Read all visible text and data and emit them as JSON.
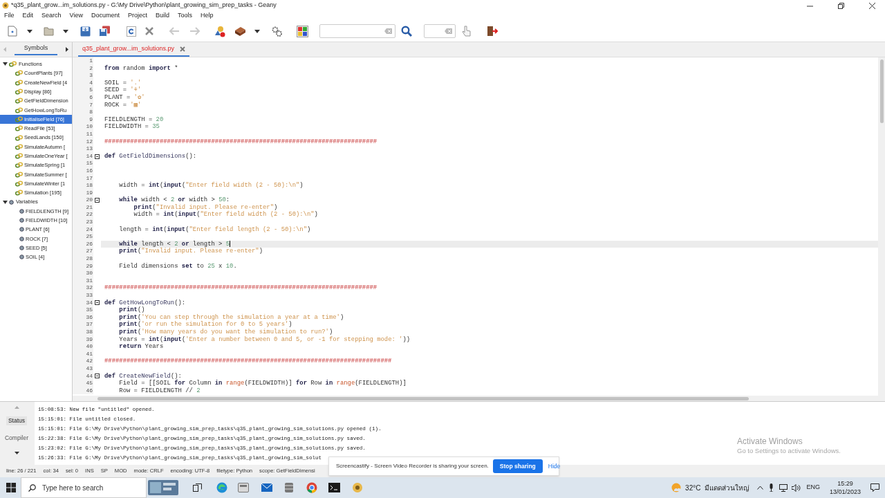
{
  "window": {
    "title": "*q35_plant_grow...im_solutions.py - G:\\My Drive\\Python\\plant_growing_sim_prep_tasks - Geany"
  },
  "menu": [
    "File",
    "Edit",
    "Search",
    "View",
    "Document",
    "Project",
    "Build",
    "Tools",
    "Help"
  ],
  "sidebar": {
    "tab": "Symbols",
    "tree": [
      {
        "label": "Functions",
        "kind": "function",
        "expanded": true,
        "selected": false,
        "children": [
          {
            "label": "CountPlants [97]",
            "kind": "function",
            "selected": false
          },
          {
            "label": "CreateNewField [4",
            "kind": "function",
            "selected": false
          },
          {
            "label": "Display [86]",
            "kind": "function",
            "selected": false
          },
          {
            "label": "GetFieldDimension",
            "kind": "function",
            "selected": false
          },
          {
            "label": "GetHowLongToRu",
            "kind": "function",
            "selected": false
          },
          {
            "label": "InitialiseField [76]",
            "kind": "function",
            "selected": true
          },
          {
            "label": "ReadFile [53]",
            "kind": "function",
            "selected": false
          },
          {
            "label": "SeedLands [150]",
            "kind": "function",
            "selected": false
          },
          {
            "label": "SimulateAutumn [",
            "kind": "function",
            "selected": false
          },
          {
            "label": "SimulateOneYear [",
            "kind": "function",
            "selected": false
          },
          {
            "label": "SimulateSpring [1",
            "kind": "function",
            "selected": false
          },
          {
            "label": "SimulateSummer [",
            "kind": "function",
            "selected": false
          },
          {
            "label": "SimulateWinter [1",
            "kind": "function",
            "selected": false
          },
          {
            "label": "Simulation [195]",
            "kind": "function",
            "selected": false
          }
        ]
      },
      {
        "label": "Variables",
        "kind": "variable",
        "expanded": true,
        "selected": false,
        "children": [
          {
            "label": "FIELDLENGTH [9]",
            "kind": "variable",
            "selected": false
          },
          {
            "label": "FIELDWIDTH [10]",
            "kind": "variable",
            "selected": false
          },
          {
            "label": "PLANT [6]",
            "kind": "variable",
            "selected": false
          },
          {
            "label": "ROCK [7]",
            "kind": "variable",
            "selected": false
          },
          {
            "label": "SEED [5]",
            "kind": "variable",
            "selected": false
          },
          {
            "label": "SOIL [4]",
            "kind": "variable",
            "selected": false
          }
        ]
      }
    ]
  },
  "editor_tab": {
    "label": "q35_plant_grow...im_solutions.py",
    "modified": true
  },
  "lines": [
    {
      "n": "1",
      "fold": false,
      "current": false
    },
    {
      "n": "2",
      "fold": false,
      "current": false,
      "tokens": [
        {
          "kind": "kw",
          "text": "from"
        },
        {
          "kind": "plain",
          "text": " random "
        },
        {
          "kind": "kw",
          "text": "import"
        },
        {
          "kind": "plain",
          "text": " *"
        }
      ]
    },
    {
      "n": "3",
      "fold": false,
      "current": false
    },
    {
      "n": "4",
      "fold": false,
      "current": false,
      "tokens": [
        {
          "kind": "plain",
          "text": "SOIL = "
        },
        {
          "kind": "str",
          "text": "'.'"
        }
      ]
    },
    {
      "n": "5",
      "fold": false,
      "current": false,
      "tokens": [
        {
          "kind": "plain",
          "text": "SEED = "
        },
        {
          "kind": "str",
          "text": "'⚘'"
        }
      ]
    },
    {
      "n": "6",
      "fold": false,
      "current": false,
      "tokens": [
        {
          "kind": "plain",
          "text": "PLANT = "
        },
        {
          "kind": "str",
          "text": "'✿'"
        }
      ]
    },
    {
      "n": "7",
      "fold": false,
      "current": false,
      "tokens": [
        {
          "kind": "plain",
          "text": "ROCK = "
        },
        {
          "kind": "str",
          "text": "'▩'"
        }
      ]
    },
    {
      "n": "8",
      "fold": false,
      "current": false
    },
    {
      "n": "9",
      "fold": false,
      "current": false,
      "tokens": [
        {
          "kind": "plain",
          "text": "FIELDLENGTH = "
        },
        {
          "kind": "num",
          "text": "20"
        }
      ]
    },
    {
      "n": "10",
      "fold": false,
      "current": false,
      "tokens": [
        {
          "kind": "plain",
          "text": "FIELDWIDTH = "
        },
        {
          "kind": "num",
          "text": "35"
        }
      ]
    },
    {
      "n": "11",
      "fold": false,
      "current": false
    },
    {
      "n": "12",
      "fold": false,
      "current": false,
      "tokens": [
        {
          "kind": "hash",
          "text": "##########################################################################"
        }
      ]
    },
    {
      "n": "13",
      "fold": false,
      "current": false
    },
    {
      "n": "14",
      "fold": true,
      "current": false,
      "tokens": [
        {
          "kind": "kw",
          "text": "def"
        },
        {
          "kind": "name",
          "text": " GetFieldDimensions"
        },
        {
          "kind": "plain",
          "text": "():"
        }
      ]
    },
    {
      "n": "15",
      "fold": false,
      "current": false
    },
    {
      "n": "16",
      "fold": false,
      "current": false
    },
    {
      "n": "17",
      "fold": false,
      "current": false
    },
    {
      "n": "18",
      "fold": false,
      "current": false,
      "tokens": [
        {
          "kind": "plain",
          "text": "    width = "
        },
        {
          "kind": "kw",
          "text": "int"
        },
        {
          "kind": "plain",
          "text": "("
        },
        {
          "kind": "kw",
          "text": "input"
        },
        {
          "kind": "plain",
          "text": "("
        },
        {
          "kind": "str",
          "text": "\"Enter field width (2 - 50):\\n\""
        },
        {
          "kind": "plain",
          "text": ")"
        }
      ]
    },
    {
      "n": "19",
      "fold": false,
      "current": false
    },
    {
      "n": "20",
      "fold": true,
      "current": false,
      "tokens": [
        {
          "kind": "kw",
          "text": "    while"
        },
        {
          "kind": "plain",
          "text": " width < "
        },
        {
          "kind": "num",
          "text": "2"
        },
        {
          "kind": "kw",
          "text": " or"
        },
        {
          "kind": "plain",
          "text": " width > "
        },
        {
          "kind": "num",
          "text": "50"
        },
        {
          "kind": "plain",
          "text": ":"
        }
      ]
    },
    {
      "n": "21",
      "fold": false,
      "current": false,
      "tokens": [
        {
          "kind": "kw",
          "text": "        print"
        },
        {
          "kind": "plain",
          "text": "("
        },
        {
          "kind": "str",
          "text": "\"Invalid input. Please re-enter\""
        },
        {
          "kind": "plain",
          "text": ")"
        }
      ]
    },
    {
      "n": "22",
      "fold": false,
      "current": false,
      "tokens": [
        {
          "kind": "plain",
          "text": "        width = "
        },
        {
          "kind": "kw",
          "text": "int"
        },
        {
          "kind": "plain",
          "text": "("
        },
        {
          "kind": "kw",
          "text": "input"
        },
        {
          "kind": "plain",
          "text": "("
        },
        {
          "kind": "str",
          "text": "\"Enter field width (2 - 50):\\n\""
        },
        {
          "kind": "plain",
          "text": ")"
        }
      ]
    },
    {
      "n": "23",
      "fold": false,
      "current": false
    },
    {
      "n": "24",
      "fold": false,
      "current": false,
      "tokens": [
        {
          "kind": "plain",
          "text": "    length = "
        },
        {
          "kind": "kw",
          "text": "int"
        },
        {
          "kind": "plain",
          "text": "("
        },
        {
          "kind": "kw",
          "text": "input"
        },
        {
          "kind": "plain",
          "text": "("
        },
        {
          "kind": "str",
          "text": "\"Enter field length (2 - 50):\\n\""
        },
        {
          "kind": "plain",
          "text": ")"
        }
      ]
    },
    {
      "n": "25",
      "fold": false,
      "current": false
    },
    {
      "n": "26",
      "fold": false,
      "current": true,
      "tokens": [
        {
          "kind": "kw",
          "text": "    while"
        },
        {
          "kind": "plain",
          "text": " length < "
        },
        {
          "kind": "num",
          "text": "2"
        },
        {
          "kind": "kw",
          "text": " or"
        },
        {
          "kind": "plain",
          "text": " length > "
        },
        {
          "kind": "num",
          "text": "5"
        }
      ]
    },
    {
      "n": "27",
      "fold": false,
      "current": false,
      "tokens": [
        {
          "kind": "kw",
          "text": "    print"
        },
        {
          "kind": "plain",
          "text": "("
        },
        {
          "kind": "str",
          "text": "\"Invalid input. Please re-enter\""
        },
        {
          "kind": "plain",
          "text": ")"
        }
      ]
    },
    {
      "n": "28",
      "fold": false,
      "current": false
    },
    {
      "n": "29",
      "fold": false,
      "current": false,
      "tokens": [
        {
          "kind": "plain",
          "text": "    Field dimensions "
        },
        {
          "kind": "kw",
          "text": "set"
        },
        {
          "kind": "plain",
          "text": " to "
        },
        {
          "kind": "num",
          "text": "25"
        },
        {
          "kind": "plain",
          "text": " x "
        },
        {
          "kind": "num",
          "text": "10"
        },
        {
          "kind": "plain",
          "text": "."
        }
      ]
    },
    {
      "n": "30",
      "fold": false,
      "current": false
    },
    {
      "n": "31",
      "fold": false,
      "current": false
    },
    {
      "n": "32",
      "fold": false,
      "current": false,
      "tokens": [
        {
          "kind": "hash",
          "text": "##########################################################################"
        }
      ]
    },
    {
      "n": "33",
      "fold": false,
      "current": false
    },
    {
      "n": "34",
      "fold": true,
      "current": false,
      "tokens": [
        {
          "kind": "kw",
          "text": "def"
        },
        {
          "kind": "name",
          "text": " GetHowLongToRun"
        },
        {
          "kind": "plain",
          "text": "():"
        }
      ]
    },
    {
      "n": "35",
      "fold": false,
      "current": false,
      "tokens": [
        {
          "kind": "kw",
          "text": "    print"
        },
        {
          "kind": "plain",
          "text": "()"
        }
      ]
    },
    {
      "n": "36",
      "fold": false,
      "current": false,
      "tokens": [
        {
          "kind": "kw",
          "text": "    print"
        },
        {
          "kind": "plain",
          "text": "("
        },
        {
          "kind": "str",
          "text": "'You can step through the simulation a year at a time'"
        },
        {
          "kind": "plain",
          "text": ")"
        }
      ]
    },
    {
      "n": "37",
      "fold": false,
      "current": false,
      "tokens": [
        {
          "kind": "kw",
          "text": "    print"
        },
        {
          "kind": "plain",
          "text": "("
        },
        {
          "kind": "str",
          "text": "'or run the simulation for 0 to 5 years'"
        },
        {
          "kind": "plain",
          "text": ")"
        }
      ]
    },
    {
      "n": "38",
      "fold": false,
      "current": false,
      "tokens": [
        {
          "kind": "kw",
          "text": "    print"
        },
        {
          "kind": "plain",
          "text": "("
        },
        {
          "kind": "str",
          "text": "'How many years do you want the simulation to run?'"
        },
        {
          "kind": "plain",
          "text": ")"
        }
      ]
    },
    {
      "n": "39",
      "fold": false,
      "current": false,
      "tokens": [
        {
          "kind": "plain",
          "text": "    Years = "
        },
        {
          "kind": "kw",
          "text": "int"
        },
        {
          "kind": "plain",
          "text": "("
        },
        {
          "kind": "kw",
          "text": "input"
        },
        {
          "kind": "plain",
          "text": "("
        },
        {
          "kind": "str",
          "text": "'Enter a number between 0 and 5, or -1 for stepping mode: '"
        },
        {
          "kind": "plain",
          "text": "))"
        }
      ]
    },
    {
      "n": "40",
      "fold": false,
      "current": false,
      "tokens": [
        {
          "kind": "kw",
          "text": "    return"
        },
        {
          "kind": "plain",
          "text": " Years"
        }
      ]
    },
    {
      "n": "41",
      "fold": false,
      "current": false
    },
    {
      "n": "42",
      "fold": false,
      "current": false,
      "tokens": [
        {
          "kind": "hash",
          "text": "##############################################################################"
        }
      ]
    },
    {
      "n": "43",
      "fold": false,
      "current": false
    },
    {
      "n": "44",
      "fold": true,
      "current": false,
      "tokens": [
        {
          "kind": "kw",
          "text": "def"
        },
        {
          "kind": "name",
          "text": " CreateNewField"
        },
        {
          "kind": "plain",
          "text": "():"
        }
      ]
    },
    {
      "n": "45",
      "fold": false,
      "current": false,
      "tokens": [
        {
          "kind": "plain",
          "text": "    Field = [[SOIL "
        },
        {
          "kind": "kw",
          "text": "for"
        },
        {
          "kind": "plain",
          "text": " Column "
        },
        {
          "kind": "kw",
          "text": "in"
        },
        {
          "kind": "builtin",
          "text": " range"
        },
        {
          "kind": "plain",
          "text": "(FIELDWIDTH)] "
        },
        {
          "kind": "kw",
          "text": "for"
        },
        {
          "kind": "plain",
          "text": " Row "
        },
        {
          "kind": "kw",
          "text": "in"
        },
        {
          "kind": "builtin",
          "text": " range"
        },
        {
          "kind": "plain",
          "text": "(FIELDLENGTH)]"
        }
      ]
    },
    {
      "n": "46",
      "fold": false,
      "current": false,
      "tokens": [
        {
          "kind": "plain",
          "text": "    Row = FIELDLENGTH // "
        },
        {
          "kind": "num",
          "text": "2"
        }
      ]
    }
  ],
  "message_tabs": [
    {
      "label": "Status",
      "selected": true
    },
    {
      "label": "Compiler",
      "selected": false
    }
  ],
  "messages": [
    "15:08:53: New file \"untitled\" opened.",
    "15:15:01: File untitled closed.",
    "15:15:01: File G:\\My Drive\\Python\\plant_growing_sim_prep_tasks\\q35_plant_growing_sim_solutions.py opened (1).",
    "15:22:38: File G:\\My Drive\\Python\\plant_growing_sim_prep_tasks\\q35_plant_growing_sim_solutions.py saved.",
    "15:23:02: File G:\\My Drive\\Python\\plant_growing_sim_prep_tasks\\q35_plant_growing_sim_solutions.py saved.",
    "15:26:33: File G:\\My Drive\\Python\\plant_growing_sim_prep_tasks\\q35_plant_growing_sim_solut"
  ],
  "status_bar": [
    "line: 26 / 221",
    "col: 34",
    "sel: 0",
    "INS",
    "SP",
    "MOD",
    "mode: CRLF",
    "encoding: UTF-8",
    "filetype: Python",
    "scope: GetFieldDimensi"
  ],
  "share_notice": {
    "text": "Screencastify - Screen Video Recorder is sharing your screen.",
    "stop_button": "Stop sharing",
    "hide_link": "Hide"
  },
  "activation_notice": {
    "title": "Activate Windows",
    "text": "Go to Settings to activate Windows."
  },
  "taskbar": {
    "search_placeholder": "Type here to search",
    "temperature": "32°C",
    "weather": "มีแดดส่วนใหญ่",
    "language": "ENG",
    "time": "15:29",
    "date": "13/01/2023"
  }
}
